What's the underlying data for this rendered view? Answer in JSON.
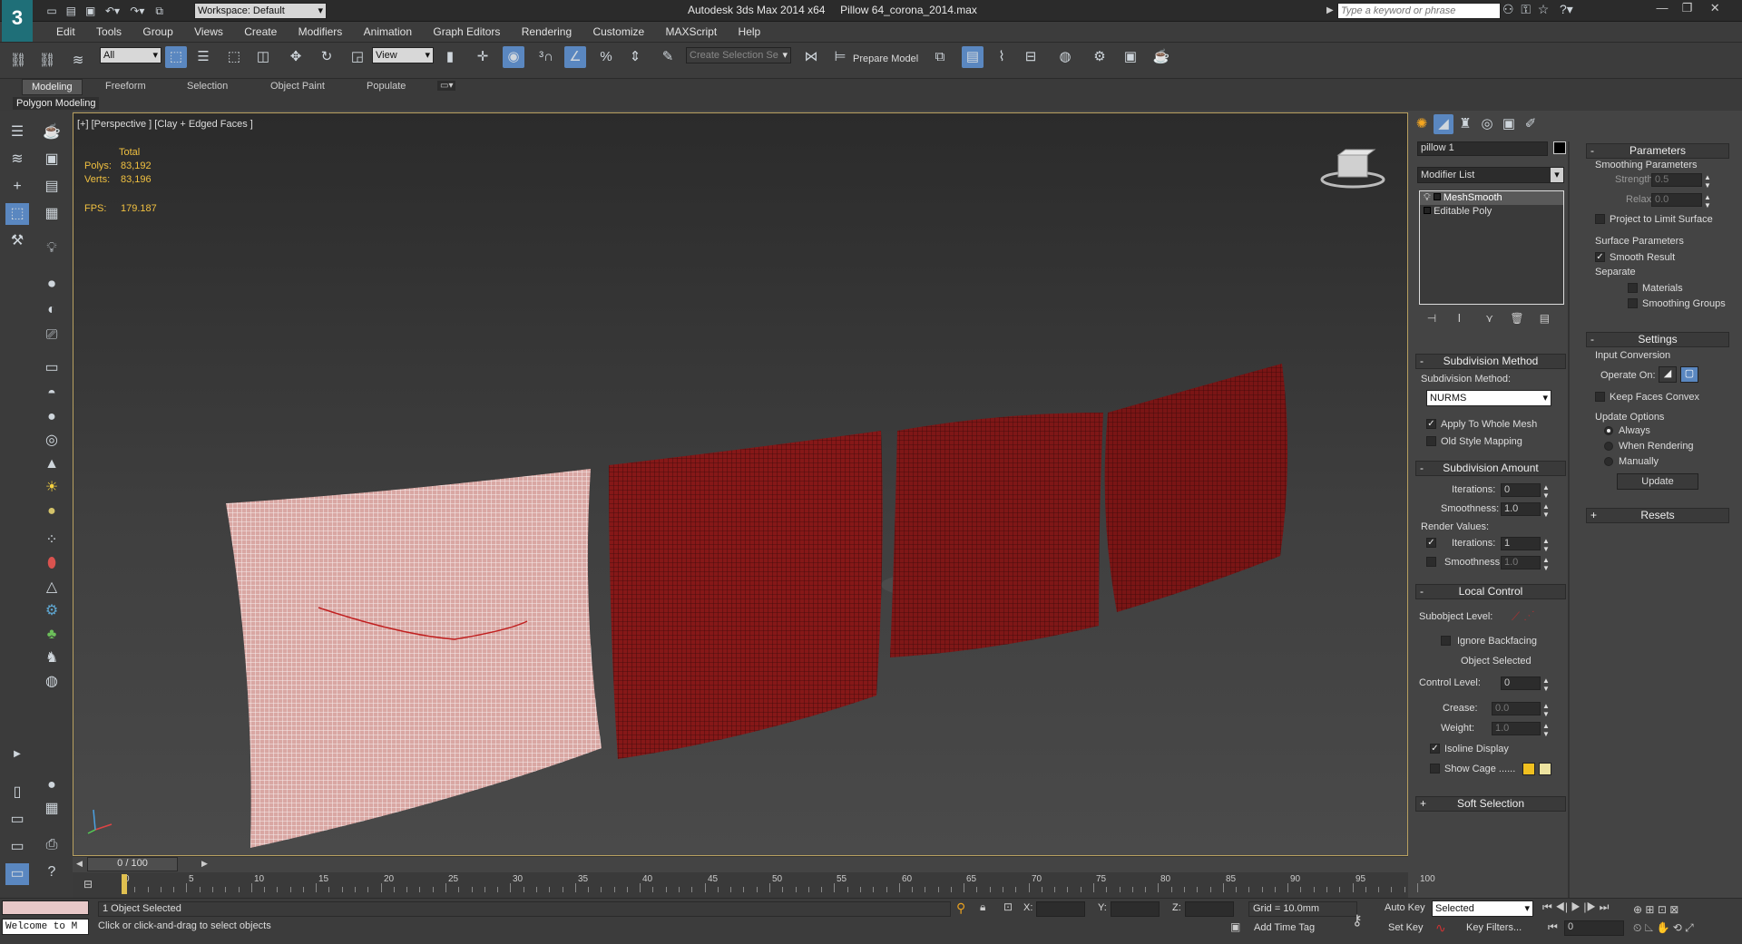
{
  "app": {
    "title": "Autodesk 3ds Max  2014 x64",
    "filename": "Pillow 64_corona_2014.max",
    "workspace": "Workspace: Default",
    "search_placeholder": "Type a keyword or phrase"
  },
  "menu": [
    "Edit",
    "Tools",
    "Group",
    "Views",
    "Create",
    "Modifiers",
    "Animation",
    "Graph Editors",
    "Rendering",
    "Customize",
    "MAXScript",
    "Help"
  ],
  "toolbar": {
    "filter": "All",
    "ref_coord": "View",
    "selection_set": "Create Selection Se",
    "prepare_model": "Prepare Model"
  },
  "ribbon": {
    "tabs": [
      "Modeling",
      "Freeform",
      "Selection",
      "Object Paint",
      "Populate"
    ],
    "active_tab": "Modeling",
    "panel_label": "Polygon Modeling"
  },
  "viewport": {
    "label": "[+] [Perspective ] [Clay + Edged Faces ]",
    "stats_header": "Total",
    "polys_label": "Polys:",
    "polys_value": "83,192",
    "verts_label": "Verts:",
    "verts_value": "83,196",
    "fps_label": "FPS:",
    "fps_value": "179.187",
    "wire_color": "#8b1a1a",
    "selected_color": "#d9a7a3"
  },
  "command_panel": {
    "object_name": "pillow 1",
    "modifier_list": "Modifier List",
    "stack": [
      "MeshSmooth",
      "Editable Poly"
    ],
    "subdivision_method": {
      "header": "Subdivision Method",
      "label": "Subdivision Method:",
      "value": "NURMS",
      "apply_whole_mesh": "Apply To Whole Mesh",
      "old_style": "Old Style Mapping"
    },
    "subdivision_amount": {
      "header": "Subdivision Amount",
      "iterations_label": "Iterations:",
      "iterations": "0",
      "smoothness_label": "Smoothness:",
      "smoothness": "1.0",
      "render_values": "Render Values:",
      "r_iterations": "1",
      "r_smoothness": "1.0"
    },
    "local_control": {
      "header": "Local Control",
      "subobject_level": "Subobject Level:",
      "ignore_backfacing": "Ignore Backfacing",
      "object_selected": "Object Selected",
      "control_level_label": "Control Level:",
      "control_level": "0",
      "crease_label": "Crease:",
      "crease": "0.0",
      "weight_label": "Weight:",
      "weight": "1.0",
      "isoline_display": "Isoline Display",
      "show_cage": "Show Cage ......"
    },
    "soft_selection": "Soft Selection",
    "parameters": {
      "header": "Parameters",
      "smoothing_params": "Smoothing Parameters",
      "strength_label": "Strength:",
      "strength": "0.5",
      "relax_label": "Relax:",
      "relax": "0.0",
      "project_limit": "Project to Limit Surface",
      "surface_params": "Surface Parameters",
      "smooth_result": "Smooth Result",
      "separate": "Separate",
      "materials": "Materials",
      "smoothing_groups": "Smoothing Groups"
    },
    "settings": {
      "header": "Settings",
      "input_conversion": "Input Conversion",
      "operate_on": "Operate On:",
      "keep_faces_convex": "Keep Faces Convex",
      "update_options": "Update Options",
      "always": "Always",
      "when_rendering": "When Rendering",
      "manually": "Manually",
      "update": "Update"
    },
    "resets": "Resets"
  },
  "timeline": {
    "frame": "0 / 100",
    "ticks": [
      "0",
      "5",
      "10",
      "15",
      "20",
      "25",
      "30",
      "35",
      "40",
      "45",
      "50",
      "55",
      "60",
      "65",
      "70",
      "75",
      "80",
      "85",
      "90",
      "95",
      "100"
    ]
  },
  "status": {
    "script_listener": "Welcome to M",
    "selected": "1 Object Selected",
    "prompt": "Click or click-and-drag to select objects",
    "x_label": "X:",
    "y_label": "Y:",
    "z_label": "Z:",
    "grid": "Grid = 10.0mm",
    "add_time_tag": "Add Time Tag",
    "auto_key": "Auto Key",
    "set_key": "Set Key",
    "key_mode": "Selected",
    "key_filters": "Key Filters...",
    "current_frame": "0"
  }
}
